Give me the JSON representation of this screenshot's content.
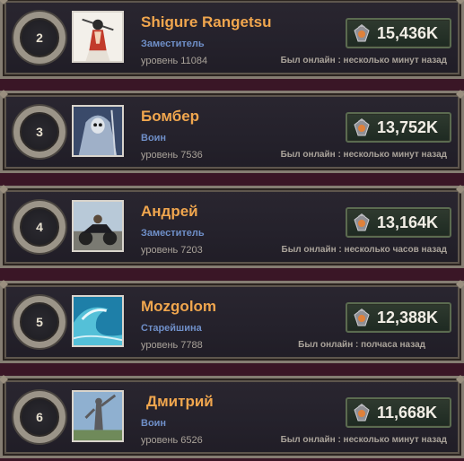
{
  "players": [
    {
      "rank": "2",
      "name": "Shigure Rangetsu",
      "role": "Заместитель",
      "level": "уровень 11084",
      "score": "15,436K",
      "online": "Был онлайн : несколько минут назад",
      "avatar": "anime-character-avatar"
    },
    {
      "rank": "3",
      "name": "Бомбер",
      "role": "Воин",
      "level": "уровень 7536",
      "score": "13,752K",
      "online": "Был онлайн : несколько минут назад",
      "avatar": "grim-reaper-avatar"
    },
    {
      "rank": "4",
      "name": "Андрей",
      "role": "Заместитель",
      "level": "уровень 7203",
      "score": "13,164K",
      "online": "Был онлайн : несколько часов назад",
      "avatar": "motorcycle-avatar"
    },
    {
      "rank": "5",
      "name": "Mozgolom",
      "role": "Старейшина",
      "level": "уровень 7788",
      "score": "12,388K",
      "online": "Был онлайн : полчаса назад",
      "avatar": "ocean-wave-avatar"
    },
    {
      "rank": "6",
      "name": "Дмитрий",
      "role": "Воин",
      "level": "уровень 6526",
      "score": "11,668K",
      "online": "Был онлайн : несколько минут назад",
      "avatar": "statue-avatar"
    }
  ],
  "colors": {
    "name": "#f0a64e",
    "role": "#6f8fc8",
    "score": "#f2eee6",
    "muted": "#aaa39a"
  },
  "icons": {
    "score": "gem-bag-icon"
  }
}
